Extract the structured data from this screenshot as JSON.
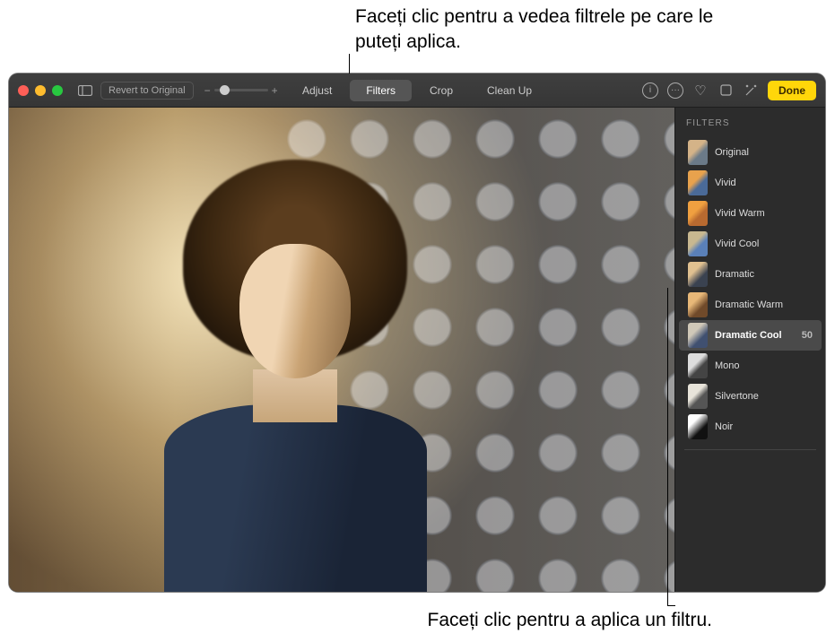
{
  "callouts": {
    "top": "Faceți clic pentru a vedea filtrele pe care le puteți aplica.",
    "bottom": "Faceți clic pentru a aplica un filtru."
  },
  "toolbar": {
    "revert": "Revert to Original",
    "tabs": {
      "adjust": "Adjust",
      "filters": "Filters",
      "crop": "Crop",
      "cleanup": "Clean Up"
    },
    "done": "Done"
  },
  "sidebar": {
    "title": "FILTERS",
    "filters": [
      {
        "label": "Original"
      },
      {
        "label": "Vivid"
      },
      {
        "label": "Vivid Warm"
      },
      {
        "label": "Vivid Cool"
      },
      {
        "label": "Dramatic"
      },
      {
        "label": "Dramatic Warm"
      },
      {
        "label": "Dramatic Cool",
        "value": "50",
        "selected": true
      },
      {
        "label": "Mono"
      },
      {
        "label": "Silvertone"
      },
      {
        "label": "Noir"
      }
    ]
  },
  "icons": {
    "info": "i",
    "more": "···",
    "heart": "♡"
  }
}
